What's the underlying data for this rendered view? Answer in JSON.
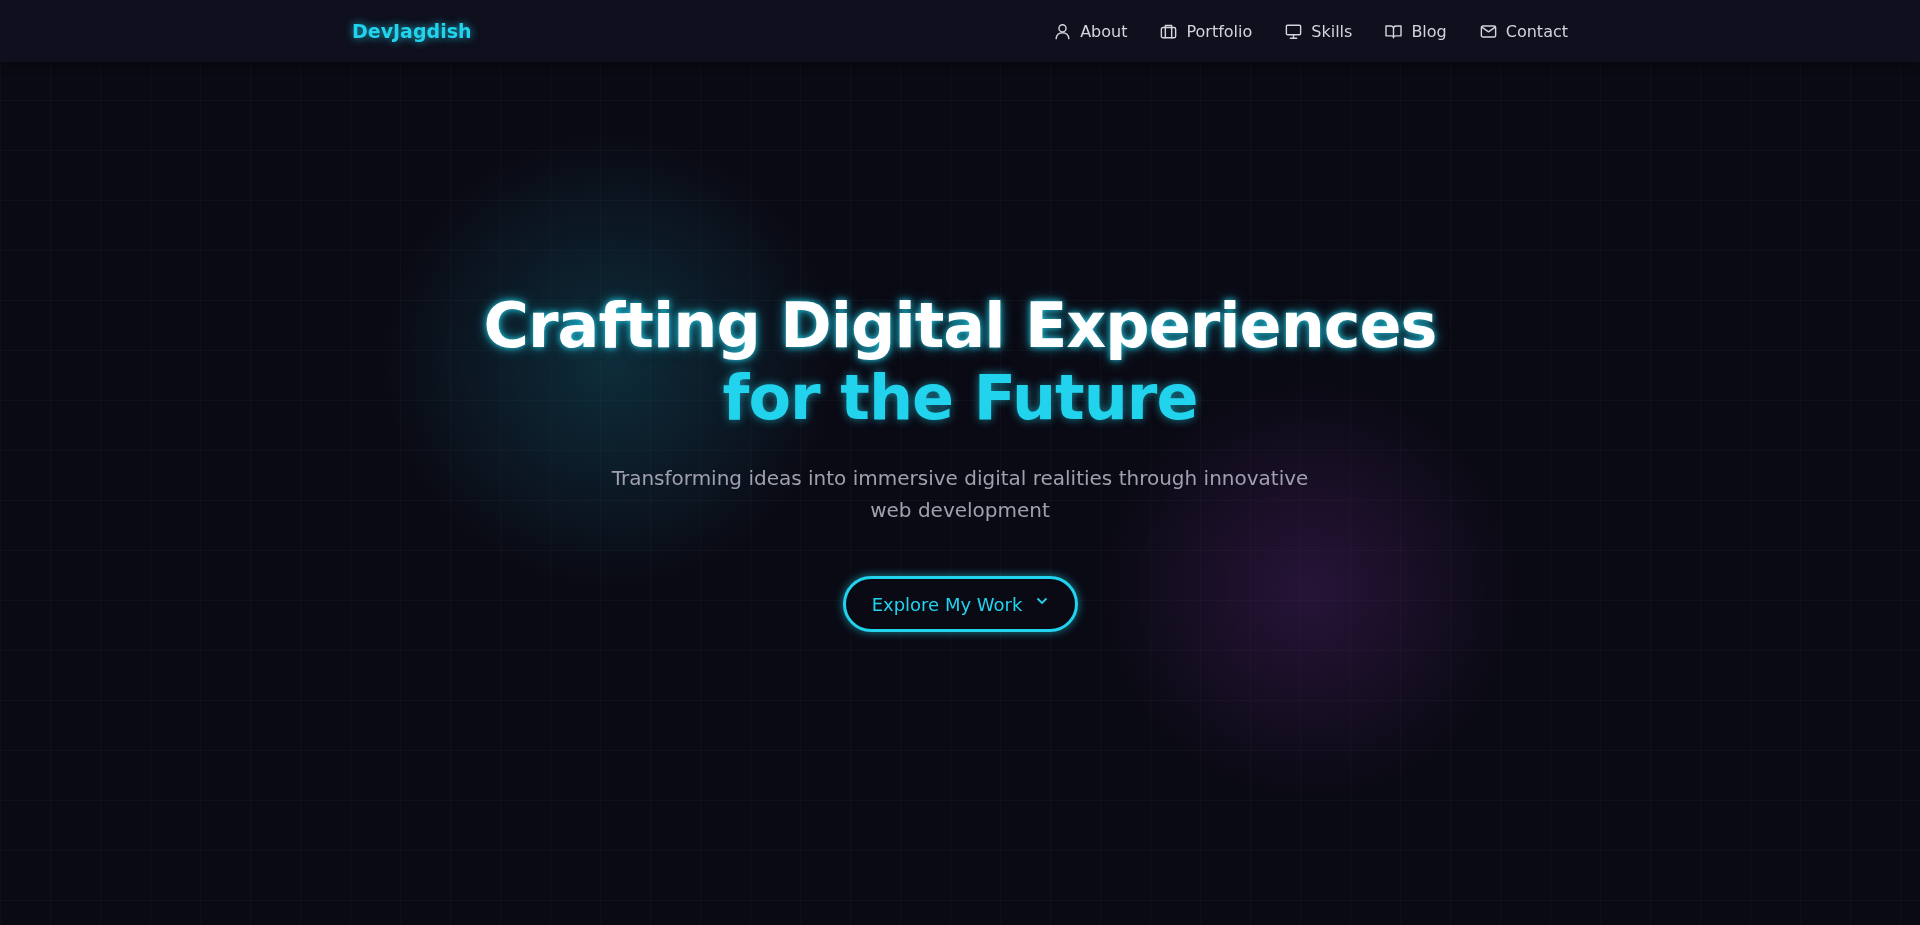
{
  "header": {
    "logo": "DevJagdish",
    "nav": [
      {
        "label": "About"
      },
      {
        "label": "Portfolio"
      },
      {
        "label": "Skills"
      },
      {
        "label": "Blog"
      },
      {
        "label": "Contact"
      }
    ]
  },
  "hero": {
    "title_line_1": "Crafting Digital Experiences",
    "title_line_2": "for the Future",
    "subtitle": "Transforming ideas into immersive digital realities through innovative web development",
    "button": "Explore My Work"
  }
}
